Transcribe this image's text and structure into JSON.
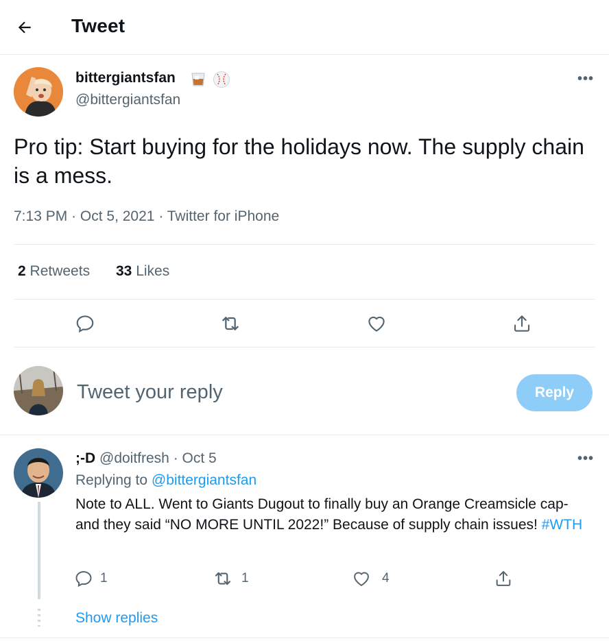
{
  "header": {
    "title": "Tweet",
    "back_icon": "arrow-left-icon"
  },
  "tweet": {
    "display_name": "bittergiantsfan",
    "emojis": [
      "whiskey-glass-icon",
      "baseball-icon"
    ],
    "handle": "@bittergiantsfan",
    "text": "Pro tip: Start buying for the holidays now. The supply chain is a mess.",
    "time": "7:13 PM",
    "date": "Oct 5, 2021",
    "source": "Twitter for iPhone",
    "retweets_count": "2",
    "retweets_label": "Retweets",
    "likes_count": "33",
    "likes_label": "Likes"
  },
  "composer": {
    "placeholder": "Tweet your reply",
    "reply_label": "Reply"
  },
  "reply_tweet": {
    "display_name": ";-D",
    "handle": "@doitfresh",
    "date": "Oct 5",
    "replying_to_label": "Replying to",
    "replying_to_handle": "@bittergiantsfan",
    "text": "Note to ALL. Went to Giants Dugout to finally buy an Orange Creamsicle cap- and they said “NO MORE UNTIL 2022!”  Because of supply chain issues!",
    "hashtag": "#WTH",
    "reply_count": "1",
    "retweet_count": "1",
    "like_count": "4",
    "show_replies": "Show replies"
  },
  "colors": {
    "accent": "#1d9bf0",
    "muted": "#536471",
    "reply_button": "#8ecdf8"
  }
}
